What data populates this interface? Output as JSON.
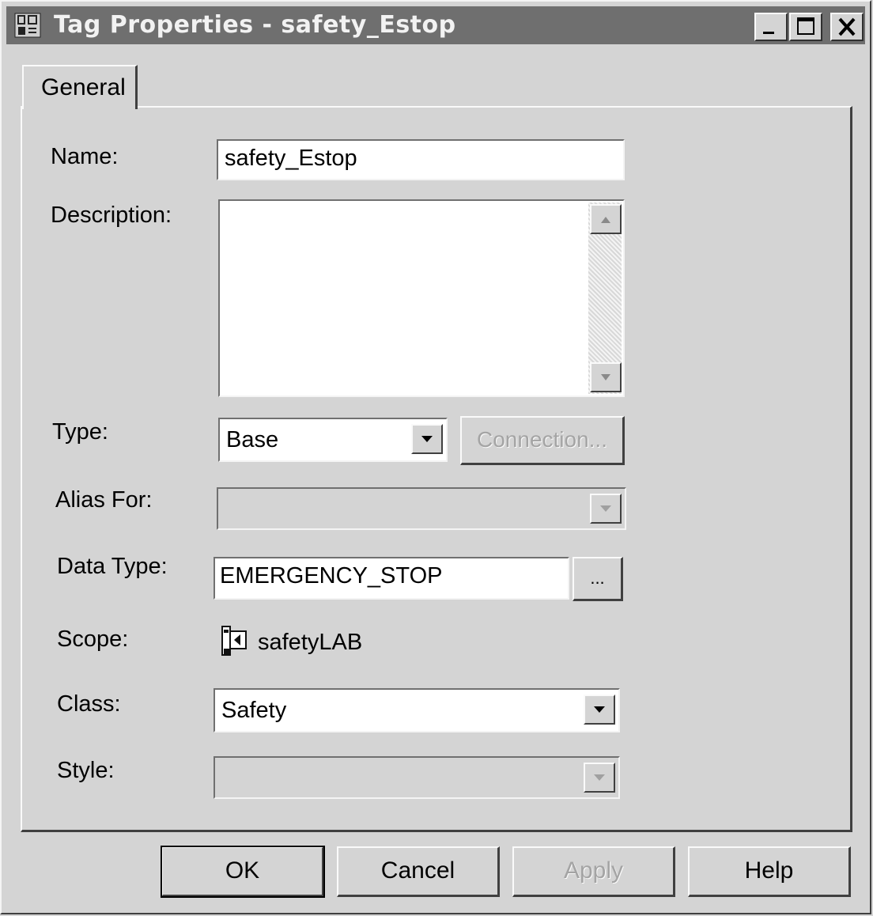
{
  "window": {
    "title": "Tag Properties - safety_Estop",
    "controls": {
      "minimize_icon": "minimize-icon",
      "maximize_icon": "maximize-icon",
      "close_icon": "close-icon"
    }
  },
  "tabs": [
    {
      "label": "General",
      "selected": true
    }
  ],
  "form": {
    "name_label": "Name:",
    "name_value": "safety_Estop",
    "description_label": "Description:",
    "description_value": "",
    "type_label": "Type:",
    "type_value": "Base",
    "connection_button": "Connection...",
    "alias_label": "Alias For:",
    "alias_value": "",
    "data_type_label": "Data Type:",
    "data_type_value": "EMERGENCY_STOP",
    "browse_button": "...",
    "scope_label": "Scope:",
    "scope_value": "safetyLAB",
    "class_label": "Class:",
    "class_value": "Safety",
    "style_label": "Style:",
    "style_value": ""
  },
  "buttons": {
    "ok": "OK",
    "cancel": "Cancel",
    "apply": "Apply",
    "help": "Help"
  },
  "colors": {
    "face": "#d4d4d4",
    "titlebar": "#6f6f6f",
    "disabled_text": "#a4a4a4"
  }
}
